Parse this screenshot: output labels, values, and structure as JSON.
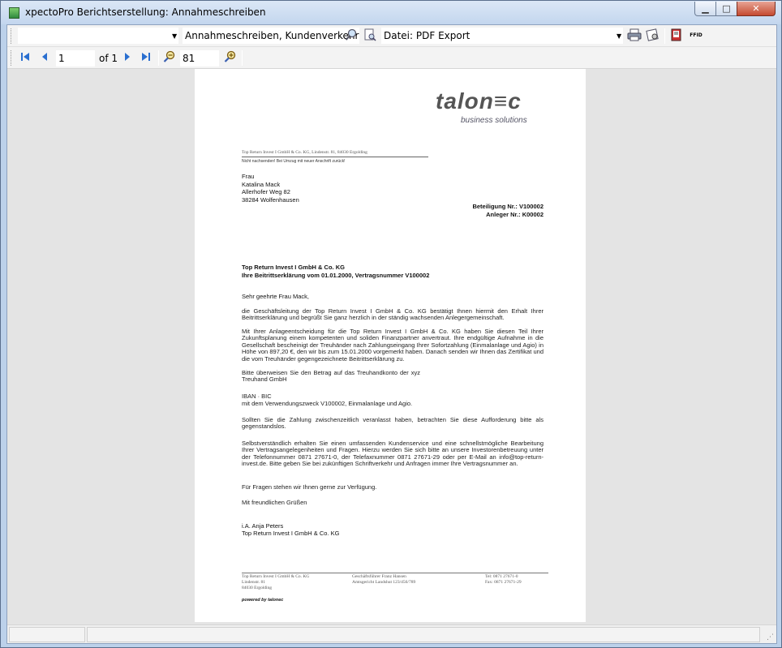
{
  "window": {
    "title": "xpectoPro Berichtserstellung: Annahmeschreiben",
    "minimize": "▁",
    "maximize": "□",
    "close": "✕"
  },
  "toolbar1": {
    "report_select_value": "",
    "search_value": "Annahmeschreiben, Kundenverkehr",
    "export_label": "Datei: PDF Export",
    "ffid_label": "FFID"
  },
  "toolbar2": {
    "page_value": "1",
    "page_of": "of 1",
    "zoom_value": "81"
  },
  "document": {
    "logo_main": "talon≡c",
    "logo_sub": "business solutions",
    "sender_line": "Top Return Invest I GmbH & Co. KG, Lindenstr. 81, 84030 Ergolding",
    "return_notice": "Nicht nachsenden! Bei Umzug mit neuer Anschrift zurück!",
    "recipient": [
      "Frau",
      "Katalina Mack",
      "Allerhofer Weg 82",
      "38284 Wolfenhausen"
    ],
    "ref": [
      "Beteiligung Nr.: V100002",
      "Anleger Nr.: K00002"
    ],
    "subject": [
      "Top Return Invest I GmbH & Co. KG",
      "Ihre Beitrittserklärung vom 01.01.2000, Vertragsnummer V100002"
    ],
    "salutation": "Sehr geehrte Frau Mack,",
    "paragraphs": [
      "die Geschäftsleitung der Top Return Invest I GmbH & Co. KG bestätigt Ihnen hiermit den Erhalt Ihrer Beitrittserklärung und begrüßt Sie ganz herzlich in der ständig wachsenden Anlegergemeinschaft.",
      "Mit Ihrer Anlageentscheidung für die Top Return Invest I GmbH & Co. KG haben Sie diesen Teil Ihrer Zukunftsplanung einem kompetenten und soliden Finanzpartner anvertraut. Ihre endgültige Aufnahme in die Gesellschaft bescheinigt der Treuhänder nach Zahlungseingang Ihrer Sofortzahlung (Einmalanlage und Agio) in Höhe von 897,20 €, den wir bis zum 15.01.2000 vorgemerkt haben. Danach senden wir Ihnen das Zertifikat und die vom Treuhänder gegengezeichnete Beitrittserklärung zu.",
      "Bitte überweisen Sie den Betrag auf das Treuhandkonto der xyz Treuhand GmbH",
      "IBAN · BIC",
      "mit dem Verwendungszweck V100002, Einmalanlage und Agio.",
      "Sollten Sie die Zahlung zwischenzeitlich veranlasst haben, betrachten Sie diese Aufforderung bitte als gegenstandslos.",
      "Selbstverständlich erhalten Sie einen umfassenden Kundenservice und eine schnellstmögliche Bearbeitung Ihrer Vertragsangelegenheiten und Fragen. Hierzu werden Sie sich bitte an unsere Investorenbetreuung unter der Telefonnummer 0871 27671-0, der Telefaxnummer 0871 27671-29 oder per E-Mail an info@top-return-invest.de. Bitte geben Sie bei zukünftigen Schriftverkehr und Anfragen immer Ihre Vertragsnummer an.",
      "Für Fragen stehen wir Ihnen gerne zur Verfügung.",
      "Mit freundlichen Grüßen"
    ],
    "signature": [
      "i.A. Anja Peters",
      "Top Return Invest I GmbH & Co. KG"
    ],
    "footer": {
      "col1": [
        "Top Return Invest I GmbH & Co. KG",
        "Lindenstr. 81",
        "84030 Ergolding"
      ],
      "col2": [
        "Geschäftsführer Franz Hansen",
        "Amtsgericht Landshut 123/456/789"
      ],
      "col3": [
        "Tel: 0871 27671-0",
        "Fax: 0871 27671-29"
      ]
    },
    "powered": "powered by talonec"
  }
}
